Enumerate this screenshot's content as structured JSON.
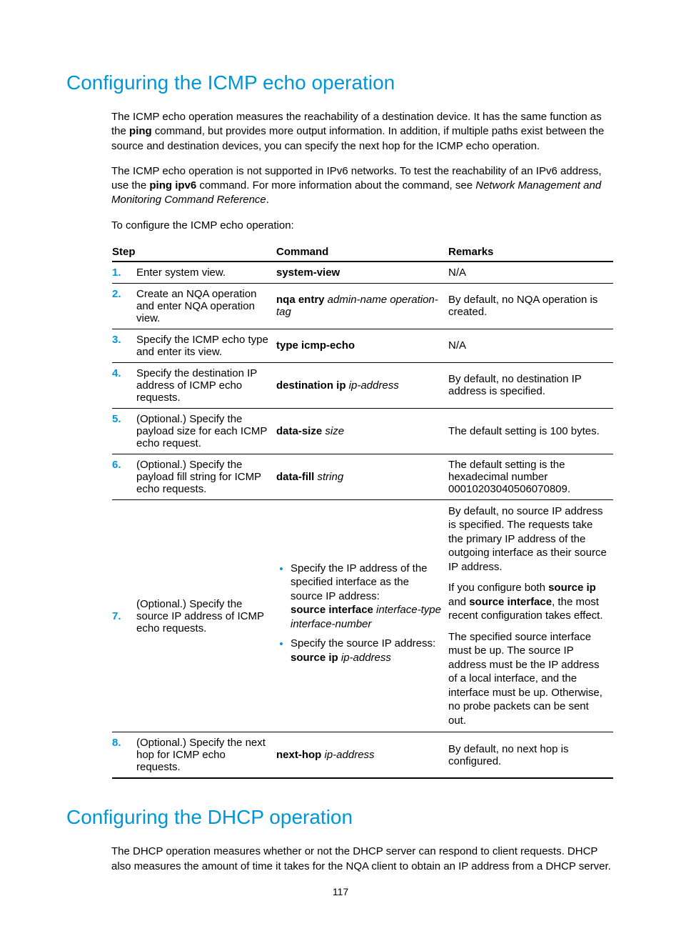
{
  "section1": {
    "title": "Configuring the ICMP echo operation",
    "p1_a": "The ICMP echo operation measures the reachability of a destination device. It has the same function as the ",
    "p1_b": "ping",
    "p1_c": " command, but provides more output information. In addition, if multiple paths exist between the source and destination devices, you can specify the next hop for the ICMP echo operation.",
    "p2_a": "The ICMP echo operation is not supported in IPv6 networks. To test the reachability of an IPv6 address, use the ",
    "p2_b": "ping ipv6",
    "p2_c": " command. For more information about the command, see ",
    "p2_d": "Network Management and Monitoring Command Reference",
    "p2_e": ".",
    "p3": "To configure the ICMP echo operation:"
  },
  "table": {
    "head_step": "Step",
    "head_cmd": "Command",
    "head_rem": "Remarks",
    "rows": [
      {
        "num": "1.",
        "desc": "Enter system view.",
        "cmd_b": "system-view",
        "rem": "N/A"
      },
      {
        "num": "2.",
        "desc": "Create an NQA operation and enter NQA operation view.",
        "cmd_b": "nqa entry",
        "cmd_i": " admin-name operation-tag",
        "rem": "By default, no NQA operation is created."
      },
      {
        "num": "3.",
        "desc": "Specify the ICMP echo type and enter its view.",
        "cmd_b": "type icmp-echo",
        "rem": "N/A"
      },
      {
        "num": "4.",
        "desc": "Specify the destination IP address of ICMP echo requests.",
        "cmd_b": "destination ip",
        "cmd_i": " ip-address",
        "rem": "By default, no destination IP address is specified."
      },
      {
        "num": "5.",
        "desc": "(Optional.) Specify the payload size for each ICMP echo request.",
        "cmd_b": "data-size",
        "cmd_i": " size",
        "rem": "The default setting is 100 bytes."
      },
      {
        "num": "6.",
        "desc": "(Optional.) Specify the payload fill string for ICMP echo requests.",
        "cmd_b": "data-fill",
        "cmd_i": " string",
        "rem": "The default setting is the hexadecimal number 00010203040506070809."
      }
    ],
    "row7": {
      "num": "7.",
      "desc": "(Optional.) Specify the source IP address of ICMP echo requests.",
      "li1_a": "Specify the IP address of the specified interface as the source IP address:",
      "li1_b": "source interface",
      "li1_i": " interface-type interface-number",
      "li2_a": "Specify the source IP address:",
      "li2_b": "source ip",
      "li2_i": " ip-address",
      "rem1": "By default, no source IP address is specified. The requests take the primary IP address of the outgoing interface as their source IP address.",
      "rem2_a": "If you configure both ",
      "rem2_b1": "source ip",
      "rem2_c": " and ",
      "rem2_b2": "source interface",
      "rem2_d": ", the most recent configuration takes effect.",
      "rem3": "The specified source interface must be up. The source IP address must be the IP address of a local interface, and the interface must be up. Otherwise, no probe packets can be sent out."
    },
    "row8": {
      "num": "8.",
      "desc": "(Optional.) Specify the next hop for ICMP echo requests.",
      "cmd_b": "next-hop",
      "cmd_i": " ip-address",
      "rem": "By default, no next hop is configured."
    }
  },
  "section2": {
    "title": "Configuring the DHCP operation",
    "p1": "The DHCP operation measures whether or not the DHCP server can respond to client requests. DHCP also measures the amount of time it takes for the NQA client to obtain an IP address from a DHCP server."
  },
  "page_number": "117"
}
